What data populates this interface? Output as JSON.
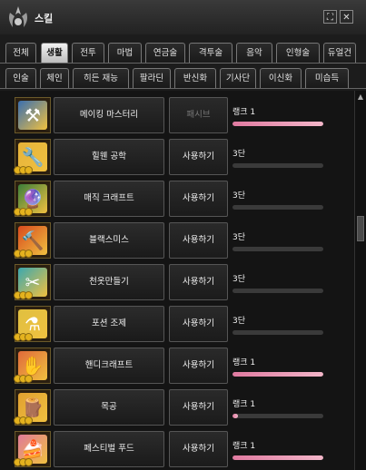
{
  "window": {
    "title": "스킬"
  },
  "titlebar": {
    "btn1": "⛶",
    "btn2": "✕"
  },
  "tabs_row1": [
    "전체",
    "생활",
    "전투",
    "마법",
    "연금술",
    "격투술",
    "음악",
    "인형술",
    "듀얼건"
  ],
  "tabs_row2": [
    "인술",
    "체인",
    "히든 재능",
    "팔라딘",
    "반신화",
    "기사단",
    "이신화",
    "미습득"
  ],
  "active_tab": "생활",
  "skills": [
    {
      "name": "메이킹 마스터리",
      "action": "패시브",
      "level": "랭크 1",
      "progress": 1.0,
      "icon": "hammer-gear-icon",
      "icon_color": "#3a6fb0",
      "glyph": "⚒"
    },
    {
      "name": "힐웬 공학",
      "action": "사용하기",
      "level": "3단",
      "progress": 0.0,
      "icon": "wrench-icon",
      "icon_color": "#e6b33a",
      "glyph": "🔧"
    },
    {
      "name": "매직 크래프트",
      "action": "사용하기",
      "level": "3단",
      "progress": 0.0,
      "icon": "magic-orb-icon",
      "icon_color": "#3b7f3a",
      "glyph": "🔮"
    },
    {
      "name": "블랙스미스",
      "action": "사용하기",
      "level": "3단",
      "progress": 0.0,
      "icon": "anvil-icon",
      "icon_color": "#d84a1e",
      "glyph": "🔨"
    },
    {
      "name": "천옷만들기",
      "action": "사용하기",
      "level": "3단",
      "progress": 0.0,
      "icon": "cloth-icon",
      "icon_color": "#3aa8b0",
      "glyph": "✂"
    },
    {
      "name": "포션 조제",
      "action": "사용하기",
      "level": "3단",
      "progress": 0.0,
      "icon": "potion-icon",
      "icon_color": "#e0c040",
      "glyph": "⚗"
    },
    {
      "name": "핸디크래프트",
      "action": "사용하기",
      "level": "랭크 1",
      "progress": 1.0,
      "icon": "glove-icon",
      "icon_color": "#e06a3a",
      "glyph": "✋"
    },
    {
      "name": "목공",
      "action": "사용하기",
      "level": "랭크 1",
      "progress": 0.06,
      "icon": "woodwork-icon",
      "icon_color": "#e0a030",
      "glyph": "🪵"
    },
    {
      "name": "페스티벌 푸드",
      "action": "사용하기",
      "level": "랭크 1",
      "progress": 1.0,
      "icon": "food-icon",
      "icon_color": "#e07a9a",
      "glyph": "🍰"
    }
  ]
}
